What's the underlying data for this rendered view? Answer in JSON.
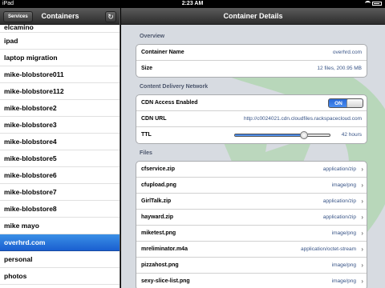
{
  "status_bar": {
    "carrier": "iPad",
    "time": "2:23 AM"
  },
  "left_pane": {
    "back_button_label": "Services",
    "title": "Containers",
    "containers": [
      "elcamino",
      "ipad",
      "laptop migration",
      "mike-blobstore011",
      "mike-blobstore112",
      "mike-blobstore2",
      "mike-blobstore3",
      "mike-blobstore4",
      "mike-blobstore5",
      "mike-blobstore6",
      "mike-blobstore7",
      "mike-blobstore8",
      "mike mayo",
      "overhrd.com",
      "personal",
      "photos"
    ],
    "selected": "overhrd.com"
  },
  "detail": {
    "title": "Container Details",
    "overview_header": "Overview",
    "overview": [
      {
        "key": "Container Name",
        "value": "overhrd.com"
      },
      {
        "key": "Size",
        "value": "12 files, 200.95 MB"
      }
    ],
    "cdn_header": "Content Delivery Network",
    "cdn_enabled_label": "CDN Access Enabled",
    "cdn_enabled_value": "ON",
    "cdn_url_label": "CDN URL",
    "cdn_url_value": "http://c0024021.cdn.cloudfiles.rackspacecloud.com",
    "ttl_label": "TTL",
    "ttl_value": "42 hours",
    "ttl_fraction": 0.73,
    "files_header": "Files",
    "files": [
      {
        "name": "cfservice.zip",
        "type": "application/zip"
      },
      {
        "name": "cfupload.png",
        "type": "image/png"
      },
      {
        "name": "GirlTalk.zip",
        "type": "application/zip"
      },
      {
        "name": "hayward.zip",
        "type": "application/zip"
      },
      {
        "name": "miketest.png",
        "type": "image/png"
      },
      {
        "name": "mreliminator.m4a",
        "type": "application/octet-stream"
      },
      {
        "name": "pizzahost.png",
        "type": "image/png"
      },
      {
        "name": "sexy-slice-list.png",
        "type": "image/png"
      }
    ]
  },
  "colors": {
    "accent": "#1f64d6",
    "value_text": "#385487",
    "watermark": "#9fd49a"
  }
}
